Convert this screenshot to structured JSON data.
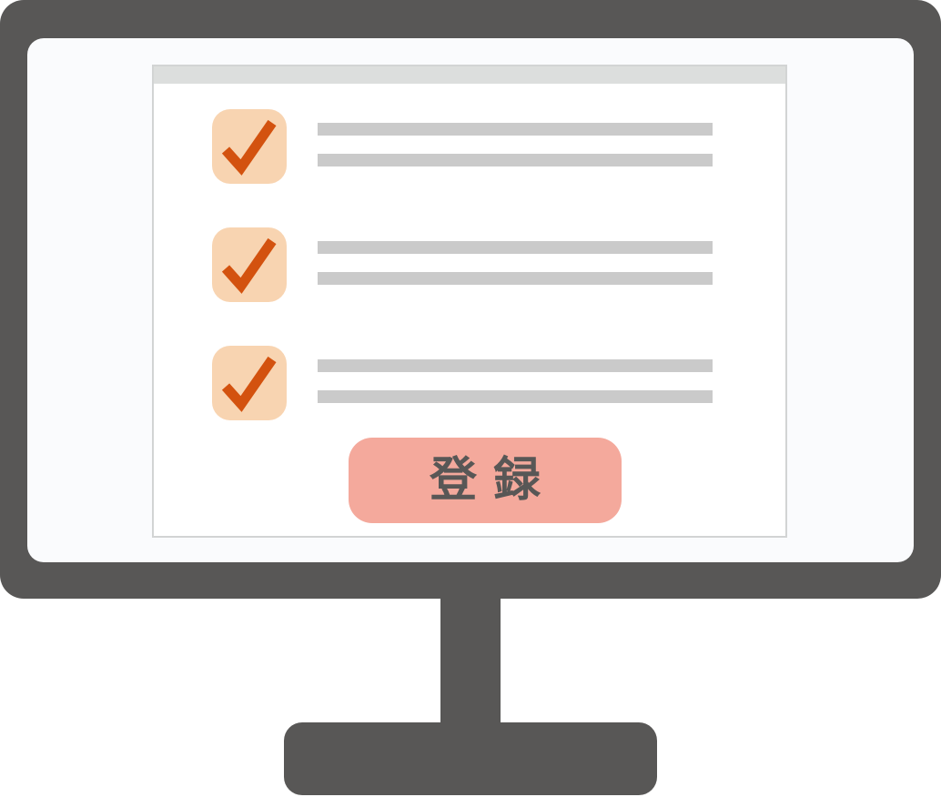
{
  "form": {
    "items": [
      {
        "checked": true
      },
      {
        "checked": true
      },
      {
        "checked": true
      }
    ],
    "submit_label": "登録"
  },
  "colors": {
    "monitor": "#585756",
    "screen": "#fafbfd",
    "window_border": "#d2d4d4",
    "titlebar": "#dcdedd",
    "checkbox_bg": "#f8d4b1",
    "checkmark": "#d3520f",
    "text_placeholder": "#cacaca",
    "button_bg": "#f4a99c",
    "button_text": "#585756"
  },
  "icons": {
    "checkmark": "check-icon"
  }
}
